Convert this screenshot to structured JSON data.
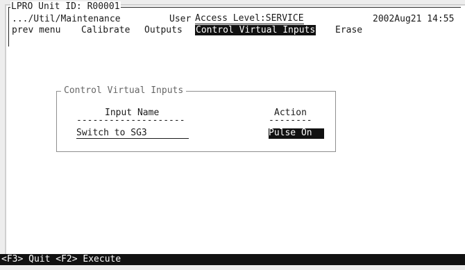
{
  "header": {
    "unit_label": "LPRO Unit ID: R00001",
    "path": ".../Util/Maintenance",
    "user_label": "User",
    "access_level": "Access Level:SERVICE",
    "datetime": "2002Aug21 14:55"
  },
  "menu": {
    "items": [
      {
        "label": "prev menu"
      },
      {
        "label": "Calibrate"
      },
      {
        "label": "Outputs"
      },
      {
        "label": "Control Virtual Inputs"
      },
      {
        "label": "Erase"
      }
    ],
    "selected": "Control Virtual Inputs"
  },
  "group": {
    "title": "Control Virtual Inputs",
    "col_input_name": "Input Name",
    "col_action": "Action",
    "col_input_rule": "--------------------",
    "col_action_rule": "--------",
    "rows": [
      {
        "input_name": "Switch to SG3",
        "action": "Pulse On"
      }
    ]
  },
  "footer": {
    "keys": "<F3> Quit <F2> Execute"
  }
}
